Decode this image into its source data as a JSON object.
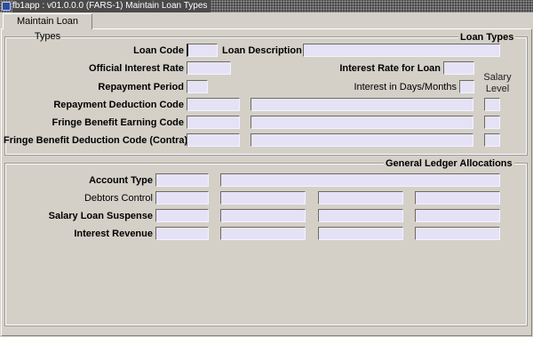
{
  "window": {
    "title": "fb1app : v01.0.0.0 (FARS-1) Maintain Loan Types"
  },
  "tab": {
    "label": "Maintain Loan Types"
  },
  "loan_types": {
    "title": "Loan Types",
    "loan_code_label": "Loan Code",
    "loan_code_value": "",
    "loan_description_label": "Loan Description",
    "loan_description_value": "",
    "official_interest_rate_label": "Official Interest Rate",
    "official_interest_rate_value": "",
    "interest_rate_for_loan_label": "Interest Rate for Loan",
    "interest_rate_for_loan_value": "",
    "repayment_period_label": "Repayment Period",
    "repayment_period_value": "",
    "interest_in_days_months_label": "Interest in Days/Months",
    "interest_in_days_months_value": "",
    "salary_level_header": "Salary Level",
    "rows": [
      {
        "label": "Repayment Deduction Code",
        "code": "",
        "description": "",
        "salary_level": ""
      },
      {
        "label": "Fringe Benefit Earning Code",
        "code": "",
        "description": "",
        "salary_level": ""
      },
      {
        "label": "Fringe Benefit Deduction Code (Contra)",
        "code": "",
        "description": "",
        "salary_level": ""
      }
    ]
  },
  "gl": {
    "title": "General Ledger Allocations",
    "account_type_label": "Account Type",
    "account_type_value": "",
    "account_type_description": "",
    "rows": [
      {
        "label": "Debtors Control",
        "values": [
          "",
          "",
          "",
          ""
        ]
      },
      {
        "label": "Salary Loan Suspense",
        "values": [
          "",
          "",
          "",
          ""
        ]
      },
      {
        "label": "Interest Revenue",
        "values": [
          "",
          "",
          "",
          ""
        ]
      }
    ]
  }
}
